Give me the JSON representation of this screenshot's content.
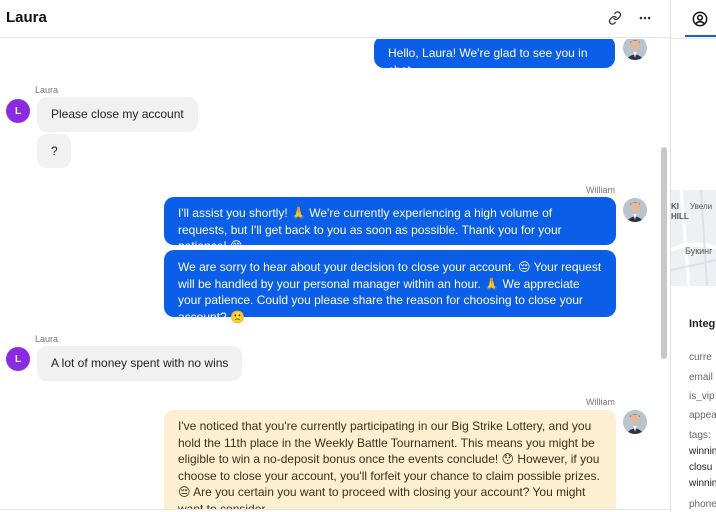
{
  "header": {
    "title": "Laura"
  },
  "messages": {
    "m1": {
      "text": "Hello, Laura! We're glad to see you in chat."
    },
    "m2": {
      "sender": "Laura",
      "avatar_letter": "L",
      "text": "Please close my account"
    },
    "m3": {
      "text": "?"
    },
    "m4": {
      "sender": "William",
      "text": "I'll assist you shortly! 🙏 We're currently experiencing a high volume of requests, but I'll get back to you as soon as possible. Thank you for your patience! 😊"
    },
    "m5": {
      "text": "We are sorry to hear about your decision to close your account. 😔 Your request will be handled by your personal manager within an hour. 🙏 We appreciate your patience. Could you please share the reason for choosing to close your account? 🙁"
    },
    "m6": {
      "sender": "Laura",
      "avatar_letter": "L",
      "text": "A lot of money spent with no wins"
    },
    "m7": {
      "sender": "William",
      "text": "I've noticed that you're currently participating in our Big Strike Lottery, and you hold the 11th place in the Weekly Battle Tournament. This means you might be eligible to win a no-deposit bonus once the events conclude! 😯 However, if you choose to close your account, you'll forfeit your chance to claim possible prizes. 😔 Are you certain you want to proceed with closing your account? You might want to consider"
    }
  },
  "panel": {
    "map_labels": {
      "top_left": "KI",
      "hill": "HILL",
      "zoom": "Увели",
      "city": "Букинг"
    },
    "section_title": "Integ",
    "fields": {
      "current": "curre",
      "email": "email",
      "is_vip": "is_vip",
      "appear": "appea",
      "tags": "tags:",
      "tag1": "winnin",
      "tag2": "closu",
      "tag3": "winnin",
      "phone": "phone"
    }
  },
  "colors": {
    "agent_bubble": "#0a5ee8",
    "user_bubble": "#f1f1f1",
    "note_bubble": "#fdf0d2",
    "user_avatar": "#8a2be2",
    "accent": "#0a5ee8"
  },
  "icons": {
    "header_link": "link-icon",
    "header_more": "more-horizontal-icon",
    "panel_tab": "user-circle-icon"
  }
}
